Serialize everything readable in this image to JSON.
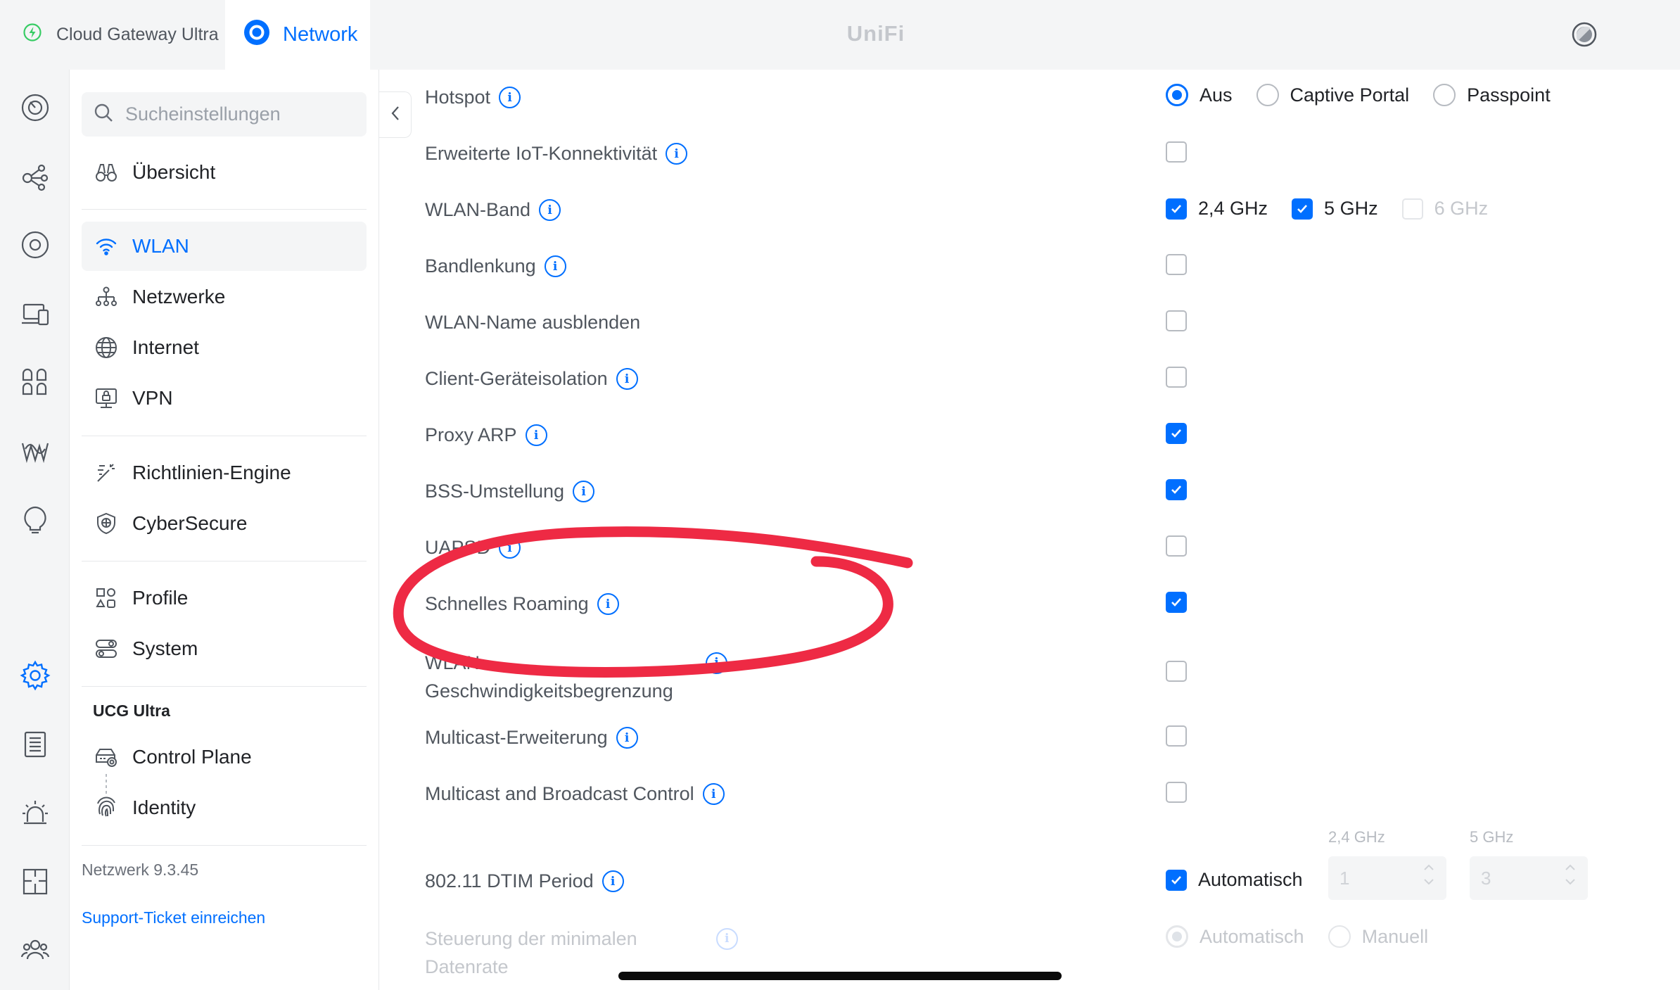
{
  "top_bar": {
    "console_name": "Cloud Gateway Ultra",
    "app_tab": "Network",
    "brand": "UniFi"
  },
  "sidebar": {
    "search_placeholder": "Sucheinstellungen",
    "overview": "Übersicht",
    "wlan": "WLAN",
    "networks": "Netzwerke",
    "internet": "Internet",
    "vpn": "VPN",
    "policy_engine": "Richtlinien-Engine",
    "cybersecure": "CyberSecure",
    "profiles": "Profile",
    "system": "System",
    "device_section": "UCG Ultra",
    "control_plane": "Control Plane",
    "identity": "Identity",
    "version": "Netzwerk 9.3.45",
    "support": "Support-Ticket einreichen"
  },
  "settings": {
    "hotspot": {
      "label": "Hotspot",
      "options": [
        "Aus",
        "Captive Portal",
        "Passpoint"
      ],
      "selected": "Aus"
    },
    "iot": {
      "label": "Erweiterte IoT-Konnektivität",
      "checked": false
    },
    "band": {
      "label": "WLAN-Band",
      "options": [
        {
          "name": "2,4 GHz",
          "checked": true,
          "disabled": false
        },
        {
          "name": "5 GHz",
          "checked": true,
          "disabled": false
        },
        {
          "name": "6 GHz",
          "checked": false,
          "disabled": true
        }
      ]
    },
    "band_steering": {
      "label": "Bandlenkung",
      "checked": false
    },
    "hide_ssid": {
      "label": "WLAN-Name ausblenden",
      "checked": false
    },
    "client_isolation": {
      "label": "Client-Geräteisolation",
      "checked": false
    },
    "proxy_arp": {
      "label": "Proxy ARP",
      "checked": true
    },
    "bss_transition": {
      "label": "BSS-Umstellung",
      "checked": true
    },
    "uapsd": {
      "label": "UAPSD",
      "checked": false
    },
    "fast_roaming": {
      "label": "Schnelles Roaming",
      "checked": true
    },
    "rate_limit": {
      "label_line1": "WLAN-",
      "label_line2": "Geschwindigkeitsbegrenzung",
      "checked": false
    },
    "multicast_enhancement": {
      "label": "Multicast-Erweiterung",
      "checked": false
    },
    "multicast_broadcast": {
      "label": "Multicast and Broadcast Control",
      "checked": false
    },
    "dtim": {
      "label": "802.11 DTIM Period",
      "auto_label": "Automatisch",
      "auto_checked": true,
      "band_24_label": "2,4 GHz",
      "band_24_value": "1",
      "band_5_label": "5 GHz",
      "band_5_value": "3"
    },
    "min_rate": {
      "label_line1": "Steuerung der minimalen",
      "label_line2": "Datenrate",
      "options": [
        "Automatisch",
        "Manuell"
      ],
      "selected": "Automatisch"
    }
  },
  "colors": {
    "accent": "#006fff",
    "annotation": "#ee2a44",
    "surface": "#f4f5f6"
  }
}
